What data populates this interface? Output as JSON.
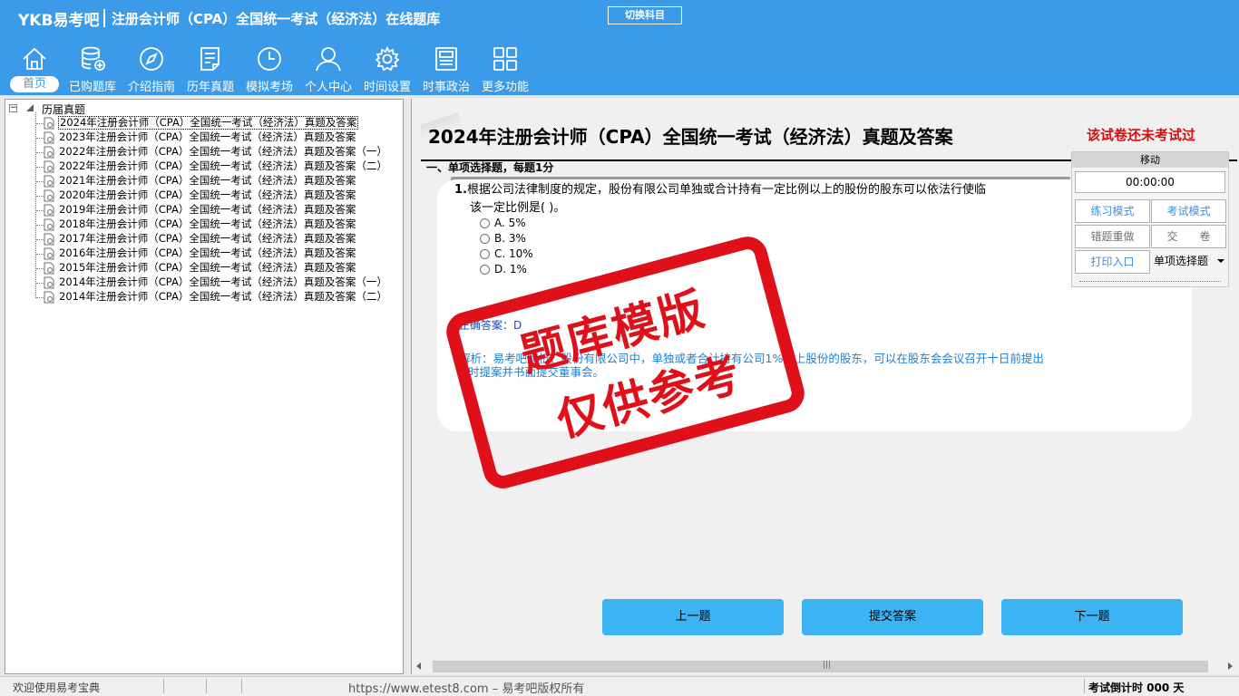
{
  "header": {
    "logo": "YKB易考吧",
    "title": "注册会计师（CPA）全国统一考试（经济法）在线题库",
    "switch_subject": "切换科目"
  },
  "nav": [
    {
      "label": "首页",
      "icon": "home-icon"
    },
    {
      "label": "已购题库",
      "icon": "database-icon"
    },
    {
      "label": "介绍指南",
      "icon": "compass-icon"
    },
    {
      "label": "历年真题",
      "icon": "document-list-icon"
    },
    {
      "label": "模拟考场",
      "icon": "clock-icon"
    },
    {
      "label": "个人中心",
      "icon": "user-icon"
    },
    {
      "label": "时间设置",
      "icon": "gear-icon"
    },
    {
      "label": "时事政治",
      "icon": "newspaper-icon"
    },
    {
      "label": "更多功能",
      "icon": "grid-icon"
    }
  ],
  "tree": {
    "root": "历届真题",
    "items": [
      "2024年注册会计师（CPA）全国统一考试（经济法）真题及答案",
      "2023年注册会计师（CPA）全国统一考试（经济法）真题及答案",
      "2022年注册会计师（CPA）全国统一考试（经济法）真题及答案（一）",
      "2022年注册会计师（CPA）全国统一考试（经济法）真题及答案（二）",
      "2021年注册会计师（CPA）全国统一考试（经济法）真题及答案",
      "2020年注册会计师（CPA）全国统一考试（经济法）真题及答案",
      "2019年注册会计师（CPA）全国统一考试（经济法）真题及答案",
      "2018年注册会计师（CPA）全国统一考试（经济法）真题及答案",
      "2017年注册会计师（CPA）全国统一考试（经济法）真题及答案",
      "2016年注册会计师（CPA）全国统一考试（经济法）真题及答案",
      "2015年注册会计师（CPA）全国统一考试（经济法）真题及答案",
      "2014年注册会计师（CPA）全国统一考试（经济法）真题及答案（一）",
      "2014年注册会计师（CPA）全国统一考试（经济法）真题及答案（二）"
    ]
  },
  "paper": {
    "title": "2024年注册会计师（CPA）全国统一考试（经济法）真题及答案",
    "status": "该试卷还未考试过",
    "section": "一、单项选择题，每题1分"
  },
  "question": {
    "number": "1.",
    "text_line1": "根据公司法律制度的规定，股份有限公司单独或合计持有一定比例以上的股份的股东可以依法行使临",
    "text_line2": "该一定比例是( )。",
    "options": [
      "A. 5%",
      "B. 3%",
      "C. 10%",
      "D. 1%"
    ],
    "answer_label": "正确答案：",
    "answer_value": "D",
    "explain_line1": "解析：易考吧解析：股份有限公司中，单独或者合计持有公司1%以上股份的股东，可以在股东会会议召开十日前提出",
    "explain_line2": "时提案并书面提交董事会。"
  },
  "stamp": {
    "line1": "题库模版",
    "line2": "仅供参考"
  },
  "tools": {
    "move": "移动",
    "timer": "00:00:00",
    "practice": "练习模式",
    "exam": "考试模式",
    "redo": "错题重做",
    "submit_paper": "交　　卷",
    "print": "打印入口",
    "type_select": "单项选择题"
  },
  "actions": {
    "prev": "上一题",
    "submit": "提交答案",
    "next": "下一题"
  },
  "status": {
    "welcome": "欢迎使用易考宝典",
    "copyright": "https://www.etest8.com – 易考吧版权所有",
    "countdown": "考试倒计时 000 天"
  }
}
